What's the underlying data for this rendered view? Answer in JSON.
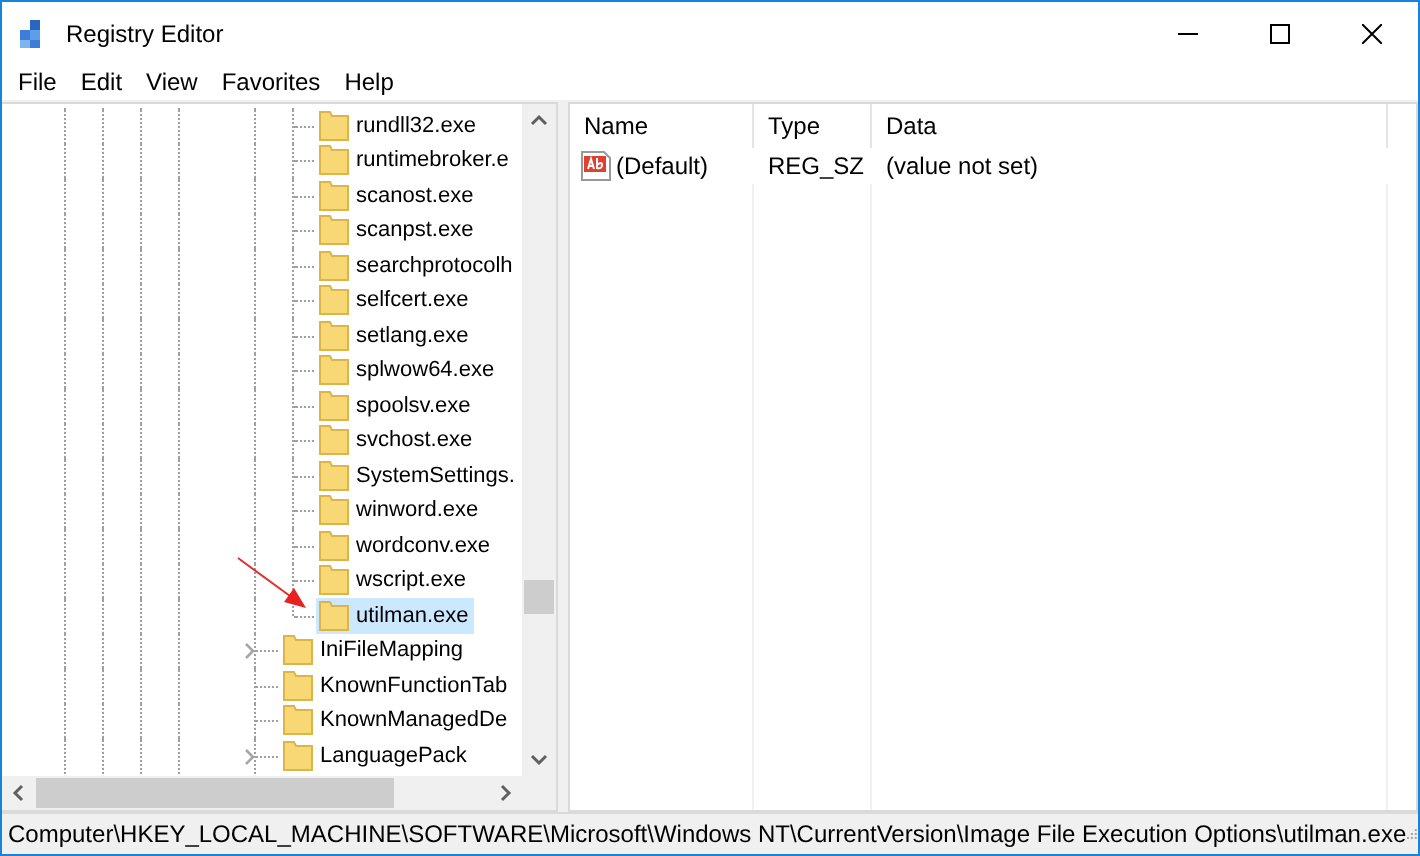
{
  "window": {
    "title": "Registry Editor"
  },
  "menu": [
    "File",
    "Edit",
    "View",
    "Favorites",
    "Help"
  ],
  "tree": {
    "nested_items": [
      {
        "label": "rundll32.exe",
        "selected": false
      },
      {
        "label": "runtimebroker.e",
        "selected": false
      },
      {
        "label": "scanost.exe",
        "selected": false
      },
      {
        "label": "scanpst.exe",
        "selected": false
      },
      {
        "label": "searchprotocolh",
        "selected": false
      },
      {
        "label": "selfcert.exe",
        "selected": false
      },
      {
        "label": "setlang.exe",
        "selected": false
      },
      {
        "label": "splwow64.exe",
        "selected": false
      },
      {
        "label": "spoolsv.exe",
        "selected": false
      },
      {
        "label": "svchost.exe",
        "selected": false
      },
      {
        "label": "SystemSettings.",
        "selected": false
      },
      {
        "label": "winword.exe",
        "selected": false
      },
      {
        "label": "wordconv.exe",
        "selected": false
      },
      {
        "label": "wscript.exe",
        "selected": false
      },
      {
        "label": "utilman.exe",
        "selected": true
      }
    ],
    "items": [
      {
        "label": "IniFileMapping",
        "selected": false,
        "expandable": true
      },
      {
        "label": "KnownFunctionTab",
        "selected": false,
        "expandable": false
      },
      {
        "label": "KnownManagedDe",
        "selected": false,
        "expandable": false
      },
      {
        "label": "LanguagePack",
        "selected": false,
        "expandable": true
      }
    ]
  },
  "values": {
    "columns": [
      "Name",
      "Type",
      "Data"
    ],
    "rows": [
      {
        "name": "(Default)",
        "type": "REG_SZ",
        "data": "(value not set)"
      }
    ]
  },
  "status_bar": "Computer\\HKEY_LOCAL_MACHINE\\SOFTWARE\\Microsoft\\Windows NT\\CurrentVersion\\Image File Execution Options\\utilman.exe"
}
